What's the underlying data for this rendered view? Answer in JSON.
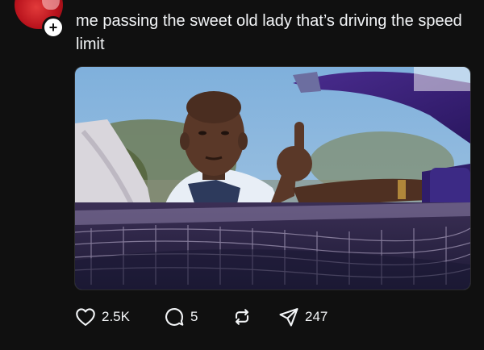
{
  "post": {
    "author": "",
    "caption": "me passing the sweet old lady that’s driving the speed limit",
    "media_alt": "",
    "follow_icon": "plus-icon"
  },
  "actions": {
    "likes": "2.5K",
    "replies": "5",
    "shares": "247",
    "icons": [
      "heart-icon",
      "reply-bubble-icon",
      "repost-icon",
      "share-send-icon"
    ]
  },
  "theme": {
    "background": "#101010",
    "text": "#f3f5f7"
  }
}
